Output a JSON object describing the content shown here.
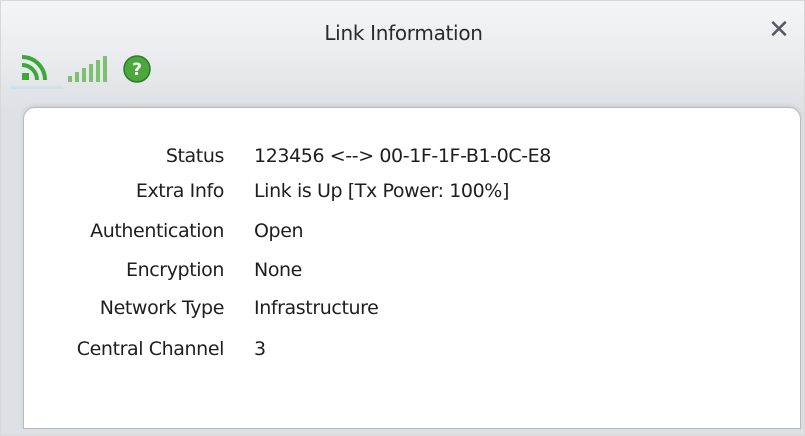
{
  "window": {
    "title": "Link Information",
    "close_glyph": "✕"
  },
  "toolbar": {
    "icons": [
      "wireless-link-icon",
      "signal-strength-icon",
      "help-icon"
    ],
    "help_glyph": "?"
  },
  "info": {
    "rows": [
      {
        "label": "Status",
        "value": "123456 <--> 00-1F-1F-B1-0C-E8"
      },
      {
        "label": "Extra Info",
        "value": "Link is Up  [Tx Power: 100%]"
      },
      {
        "label": "Authentication",
        "value": "Open"
      },
      {
        "label": "Encryption",
        "value": "None"
      },
      {
        "label": "Network Type",
        "value": "Infrastructure"
      },
      {
        "label": "Central Channel",
        "value": "3"
      }
    ]
  },
  "colors": {
    "accent_green": "#3aa935",
    "help_green": "#4aa83c"
  }
}
